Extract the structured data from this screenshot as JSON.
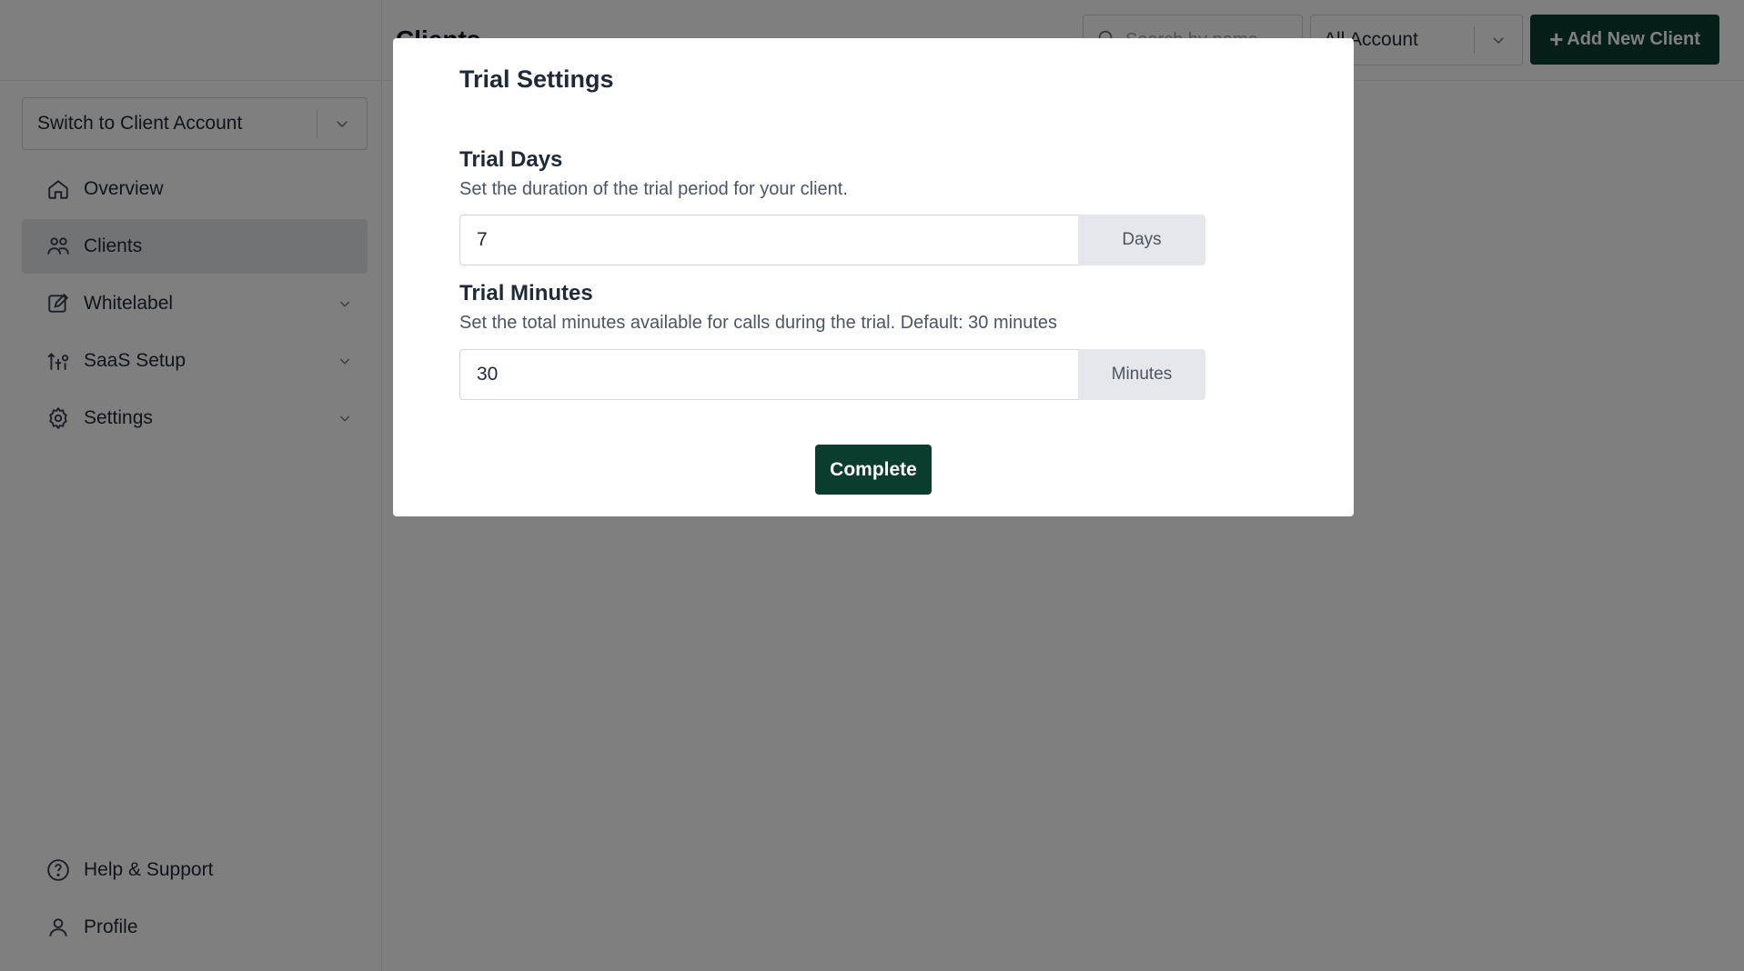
{
  "sidebar": {
    "switch_account": "Switch to Client Account",
    "items": [
      {
        "label": "Overview",
        "icon": "home-icon"
      },
      {
        "label": "Clients",
        "icon": "users-icon"
      },
      {
        "label": "Whitelabel",
        "icon": "edit-icon"
      },
      {
        "label": "SaaS Setup",
        "icon": "saas-setup-icon"
      },
      {
        "label": "Settings",
        "icon": "gear-icon"
      }
    ],
    "bottom_items": [
      {
        "label": "Help & Support",
        "icon": "help-circle-icon"
      },
      {
        "label": "Profile",
        "icon": "user-icon"
      }
    ]
  },
  "header": {
    "title": "Clients",
    "search_placeholder": "Search by name",
    "account_filter": "All Account",
    "add_button": "Add New Client"
  },
  "modal": {
    "title": "Trial Settings",
    "trial_days": {
      "label": "Trial Days",
      "description": "Set the duration of the trial period for your client.",
      "value": "7",
      "unit": "Days"
    },
    "trial_minutes": {
      "label": "Trial Minutes",
      "description": "Set the total minutes available for calls during the trial. Default: 30 minutes",
      "value": "30",
      "unit": "Minutes"
    },
    "complete_button": "Complete"
  },
  "colors": {
    "primary": "#0b3d2e",
    "active_nav": "#e5e7eb",
    "overlay": "rgba(0,0,0,0.5)"
  }
}
